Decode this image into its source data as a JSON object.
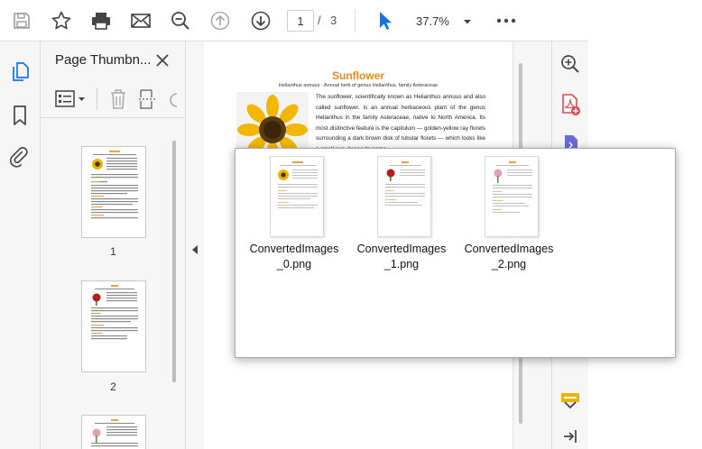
{
  "toolbar": {
    "page_current": "1",
    "page_sep": "/",
    "page_total": "3",
    "zoom": "37.7%",
    "more_label": "•••"
  },
  "thumbnail_panel": {
    "title": "Page Thumbn...",
    "pages": [
      {
        "label": "1"
      },
      {
        "label": "2"
      },
      {
        "label": ""
      }
    ]
  },
  "document": {
    "title": "Sunflower",
    "subtitle": "Helianthus annuus · Annual herb of genus Helianthus, family Asteraceae",
    "body": "The sunflower, scientifically known as Helianthus annuus and also called sunflower, is an annual herbaceous plant of the genus Helianthus in the family Asteraceae, native to North America. Its most distinctive feature is the capitulum — golden-yellow ray florets surrounding a dark brown disk of tubular florets — which looks like a small sun, hence its name."
  },
  "file_popup": {
    "files": [
      {
        "name": "ConvertedImages_0.png",
        "accent": "#e5a21a"
      },
      {
        "name": "ConvertedImages_1.png",
        "accent": "#c0392b"
      },
      {
        "name": "ConvertedImages_2.png",
        "accent": "#d98aa6"
      }
    ]
  },
  "colors": {
    "accent_blue": "#1473e6",
    "acrobat_red": "#e34850",
    "highlight_yellow": "#e8b400",
    "title_orange": "#e58a17"
  }
}
